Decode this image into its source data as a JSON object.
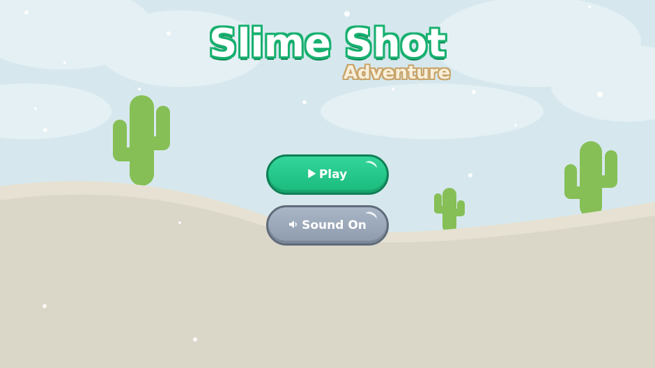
{
  "title": {
    "main": "Slime Shot",
    "sub": "Adventure"
  },
  "menu": {
    "play": {
      "icon": "play-icon",
      "label": "Play"
    },
    "sound": {
      "icon": "speaker-icon",
      "label": "Sound On"
    }
  },
  "colors": {
    "sky": "#d6e8ee",
    "ground": "#dad6c8",
    "ground_edge": "#e8e3d4",
    "cactus": "#86bf56",
    "play_button": "#22c484",
    "sound_button": "#97a3b4",
    "title_outline": "#17b06f"
  }
}
